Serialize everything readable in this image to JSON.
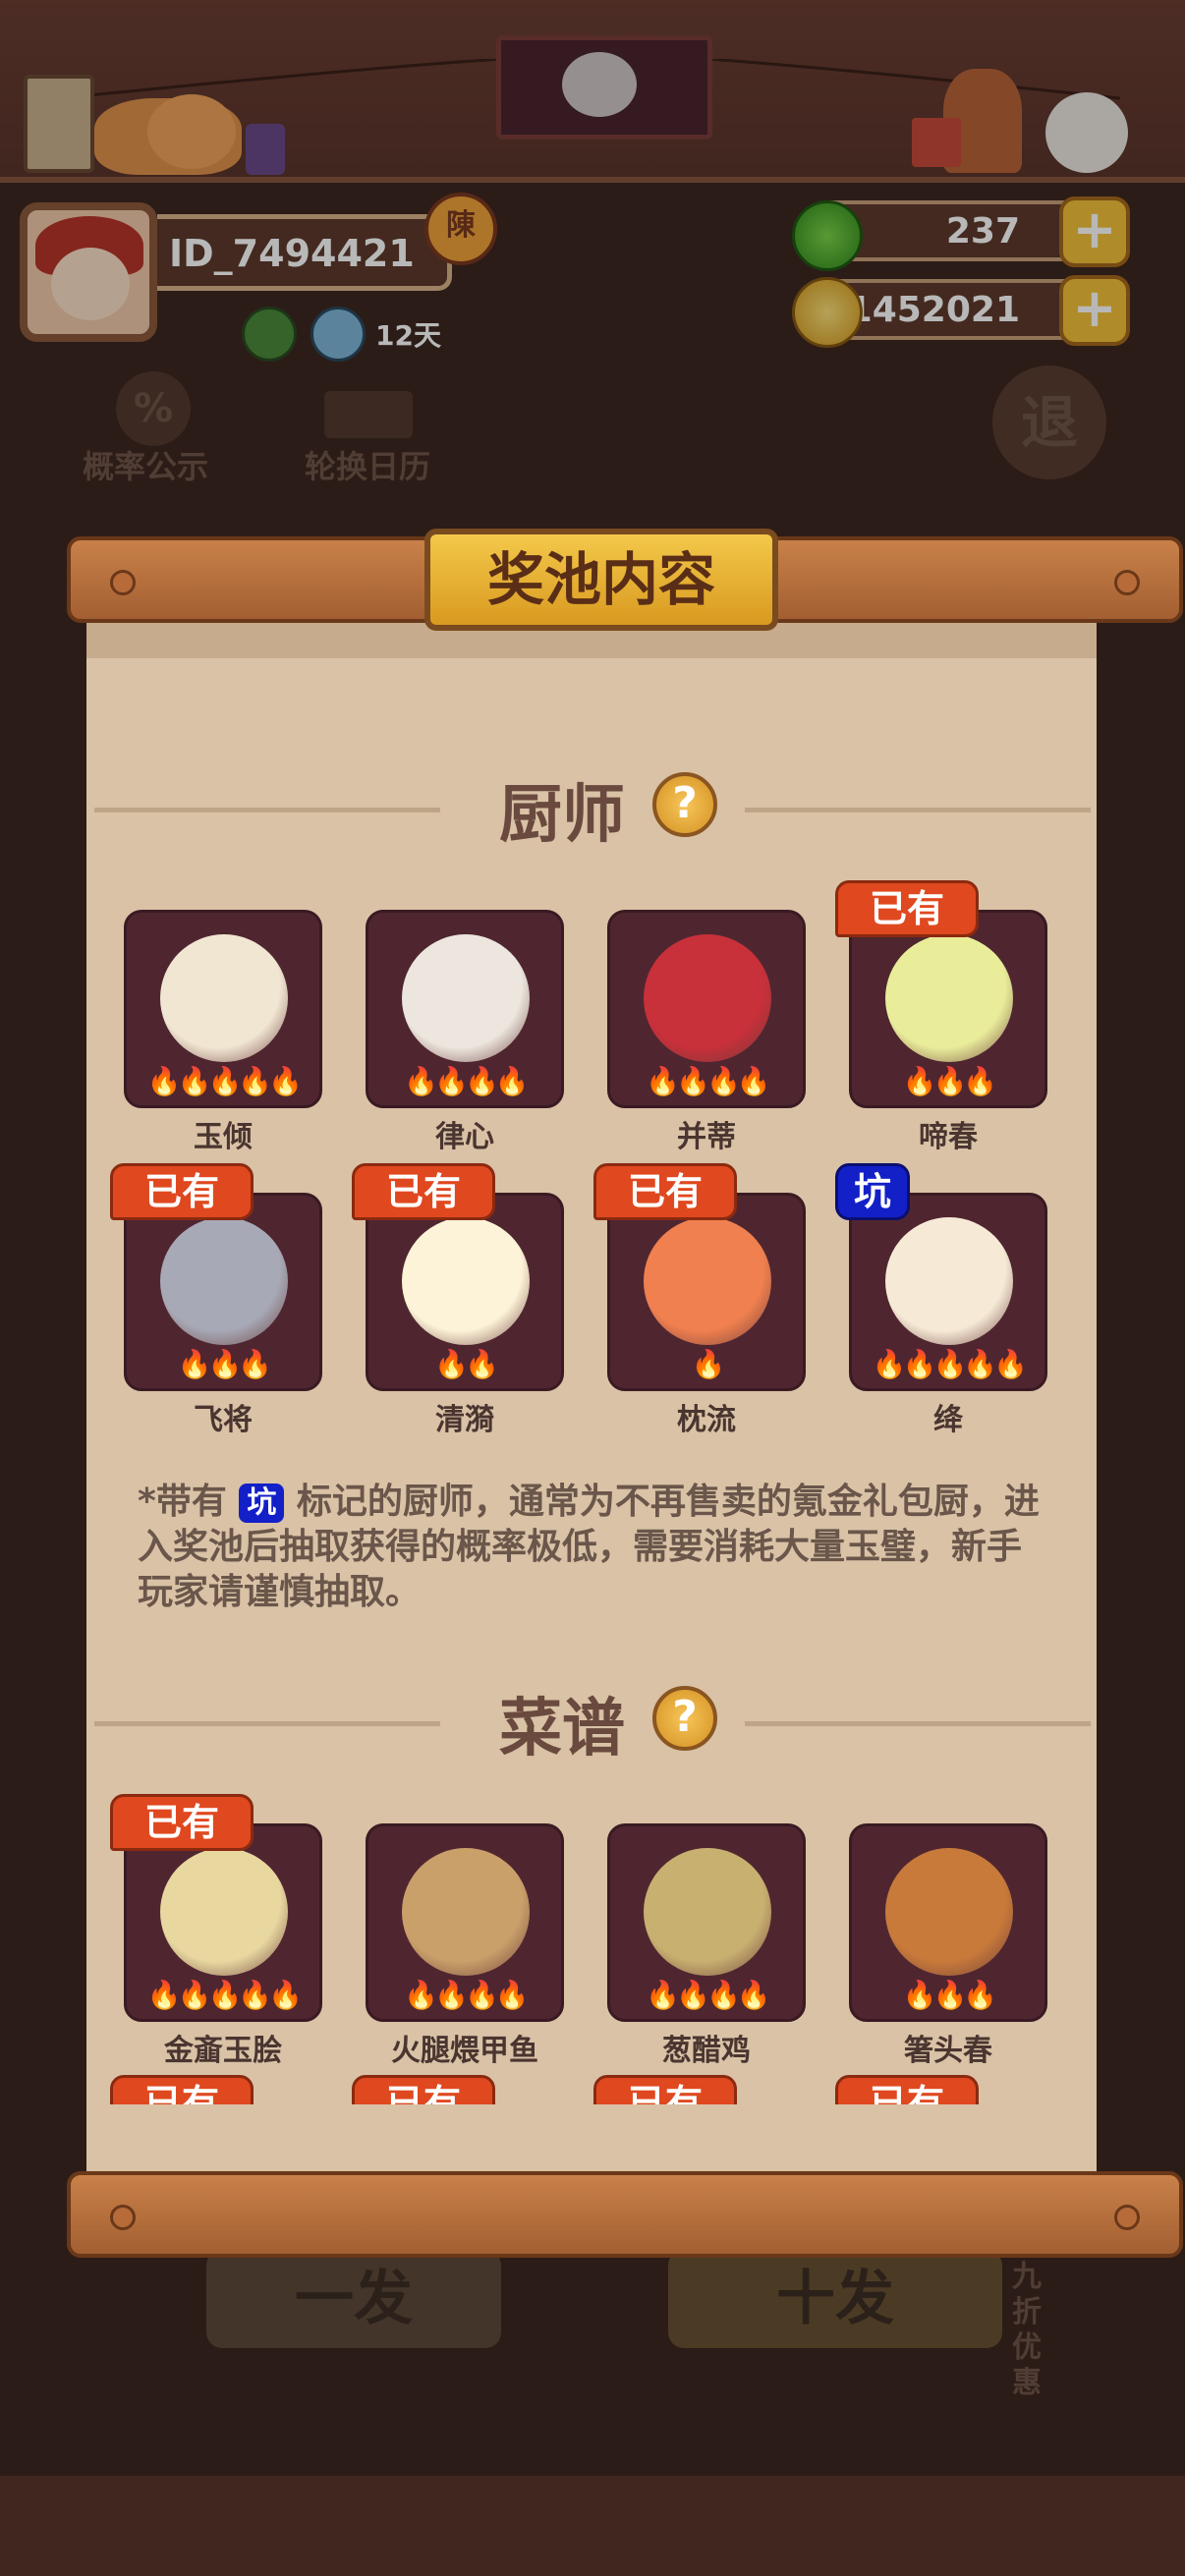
{
  "player": {
    "id": "ID_7494421",
    "vip_badge": "陳",
    "buff_days": "12天"
  },
  "resources": {
    "jade": "237",
    "coins": "1452021"
  },
  "background": {
    "probability_label": "概率公示",
    "calendar_label": "轮换日历",
    "exit_label": "退",
    "single_draw": "一发",
    "ten_draw": "十发",
    "discount": "九折优惠"
  },
  "modal": {
    "title": "奖池内容",
    "chef_section": "厨师",
    "recipe_section": "菜谱",
    "owned_tag": "已有",
    "pit_tag": "坑",
    "note_prefix": "*带有",
    "note_body": "标记的厨师，通常为不再售卖的氪金礼包厨，进入奖池后抽取获得的概率极低，需要消耗大量玉璧，新手玩家请谨慎抽取。"
  },
  "chefs": [
    {
      "name": "玉倾",
      "stars": 5,
      "owned": false,
      "pit": false,
      "color": "#f1e6d2"
    },
    {
      "name": "律心",
      "stars": 4,
      "owned": false,
      "pit": false,
      "color": "#ece6de"
    },
    {
      "name": "并蒂",
      "stars": 4,
      "owned": false,
      "pit": false,
      "color": "#c8303a"
    },
    {
      "name": "啼春",
      "stars": 3,
      "owned": true,
      "pit": false,
      "color": "#e9ed9a"
    },
    {
      "name": "飞将",
      "stars": 3,
      "owned": true,
      "pit": false,
      "color": "#a7a9b6"
    },
    {
      "name": "清漪",
      "stars": 2,
      "owned": true,
      "pit": false,
      "color": "#fdf3d8"
    },
    {
      "name": "枕流",
      "stars": 1,
      "owned": true,
      "pit": false,
      "color": "#f0804f"
    },
    {
      "name": "绛",
      "stars": 5,
      "owned": false,
      "pit": true,
      "color": "#f6ead6"
    }
  ],
  "recipes": [
    {
      "name": "金齑玉脍",
      "stars": 5,
      "owned": true,
      "color": "#e8d8a0"
    },
    {
      "name": "火腿煨甲鱼",
      "stars": 4,
      "owned": false,
      "color": "#c9a06a"
    },
    {
      "name": "葱醋鸡",
      "stars": 4,
      "owned": false,
      "color": "#c8b070"
    },
    {
      "name": "箸头春",
      "stars": 3,
      "owned": false,
      "color": "#c87a3a"
    }
  ],
  "partial_row_tags": [
    "已有",
    "已有",
    "已有",
    "已有"
  ]
}
